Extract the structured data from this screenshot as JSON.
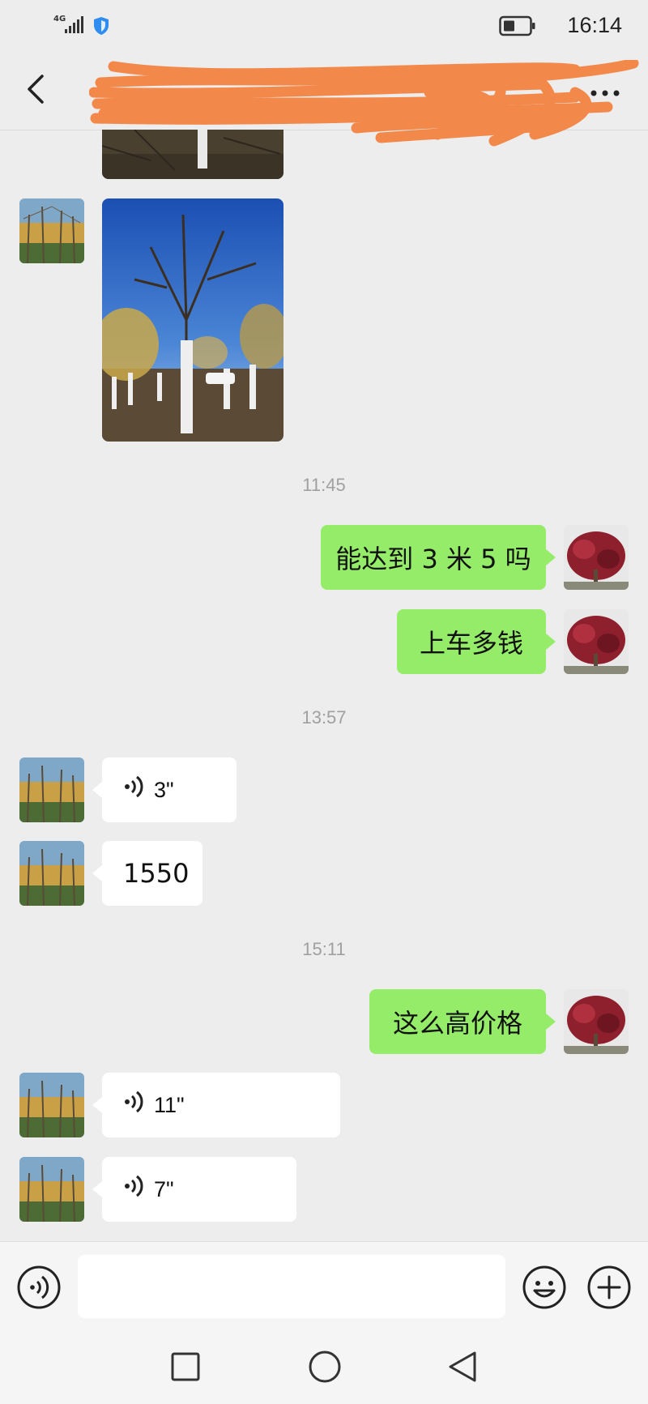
{
  "status_bar": {
    "network": "4G",
    "time": "16:14"
  },
  "header": {
    "title": ""
  },
  "messages": [
    {
      "type": "time",
      "text": "11:45"
    },
    {
      "type": "text",
      "side": "right",
      "text": "能达到 3 米 5 吗"
    },
    {
      "type": "text",
      "side": "right",
      "text": "上车多钱"
    },
    {
      "type": "time",
      "text": "13:57"
    },
    {
      "type": "voice",
      "side": "left",
      "duration": "3\""
    },
    {
      "type": "text",
      "side": "left",
      "text": "1550"
    },
    {
      "type": "time",
      "text": "15:11"
    },
    {
      "type": "text",
      "side": "right",
      "text": "这么高价格"
    },
    {
      "type": "voice",
      "side": "left",
      "duration": "11\""
    },
    {
      "type": "voice",
      "side": "left",
      "duration": "7\""
    }
  ],
  "input": {
    "placeholder": ""
  },
  "icons": {
    "back": "chevron-left-icon",
    "more": "more-dots-icon",
    "voice_toggle": "voice-icon",
    "emoji": "emoji-icon",
    "plus": "plus-icon",
    "nav_recent": "square-icon",
    "nav_home": "circle-icon",
    "nav_back": "triangle-back-icon"
  },
  "colors": {
    "bubble_self": "#95ec69",
    "bubble_other": "#ffffff",
    "background": "#ededed",
    "redaction": "#f2894a"
  }
}
